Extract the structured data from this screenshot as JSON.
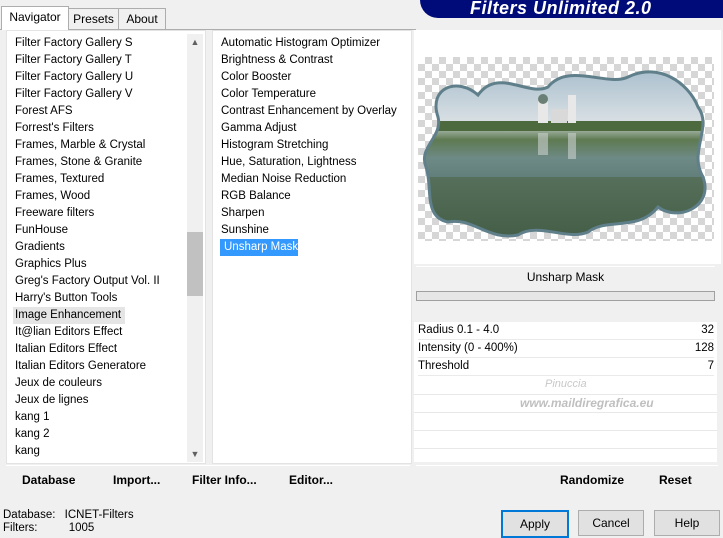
{
  "tabs": [
    "Navigator",
    "Presets",
    "About"
  ],
  "banner_title": "Filters Unlimited 2.0",
  "categories": [
    "Filter Factory Gallery S",
    "Filter Factory Gallery T",
    "Filter Factory Gallery U",
    "Filter Factory Gallery V",
    "Forest AFS",
    "Forrest's Filters",
    "Frames, Marble & Crystal",
    "Frames, Stone & Granite",
    "Frames, Textured",
    "Frames, Wood",
    "Freeware filters",
    "FunHouse",
    "Gradients",
    "Graphics Plus",
    "Greg's Factory Output Vol. II",
    "Harry's Button Tools",
    "Image Enhancement",
    "It@lian Editors Effect",
    "Italian Editors Effect",
    "Italian Editors Generatore",
    "Jeux de couleurs",
    "Jeux de lignes",
    "kang 1",
    "kang 2",
    "kang"
  ],
  "selected_category": "Image Enhancement",
  "filters": [
    "Automatic Histogram Optimizer",
    "Brightness & Contrast",
    "Color Booster",
    "Color Temperature",
    "Contrast Enhancement by Overlay",
    "Gamma Adjust",
    "Histogram Stretching",
    "Hue, Saturation, Lightness",
    "Median Noise Reduction",
    "RGB Balance",
    "Sharpen",
    "Sunshine",
    "Unsharp Mask"
  ],
  "selected_filter": "Unsharp Mask",
  "filter_name": "Unsharp Mask",
  "params": [
    {
      "label": "Radius 0.1 - 4.0",
      "value": "32"
    },
    {
      "label": "Intensity (0 - 400%)",
      "value": "128"
    },
    {
      "label": "Threshold",
      "value": "7"
    }
  ],
  "list_buttons": {
    "database": "Database",
    "import": "Import...",
    "filter_info": "Filter Info...",
    "editor": "Editor..."
  },
  "param_buttons": {
    "randomize": "Randomize",
    "reset": "Reset"
  },
  "status": {
    "database_label": "Database:",
    "database_value": "ICNET-Filters",
    "filters_label": "Filters:",
    "filters_value": "1005"
  },
  "dialog_buttons": {
    "apply": "Apply",
    "cancel": "Cancel",
    "help": "Help"
  },
  "watermark": {
    "name": "Pinuccia",
    "url": "www.maildiregrafica.eu"
  },
  "colors": {
    "banner": "#000b7a",
    "selection": "#3399ff"
  }
}
